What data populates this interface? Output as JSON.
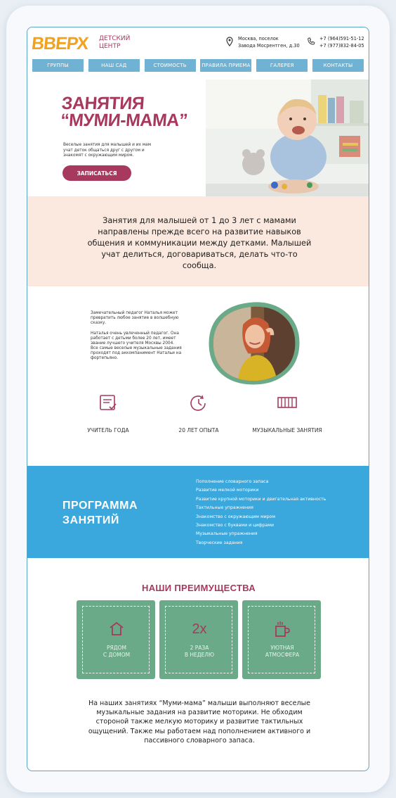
{
  "header": {
    "logo": "ВВЕРХ",
    "subtitle": "ДЕТСКИЙ ЦЕНТР",
    "address_line1": "Москва, поселок",
    "address_line2": "Завода Мосрентген, д.30",
    "phone1": "+7 (964)591-51-12",
    "phone2": "+7 (977)832-84-05"
  },
  "nav": [
    "ГРУППЫ",
    "НАШ САД",
    "СТОИМОСТЬ",
    "ПРАВИЛА ПРИЕМА",
    "ГАЛЕРЕЯ",
    "КОНТАКТЫ"
  ],
  "hero": {
    "title_line1": "ЗАНЯТИЯ",
    "title_line2": "“МУМИ-МАМА”",
    "description": "Веселые занятия для малышей и их мам учат деток общаться друг с другом и знакомят с окружающим миром.",
    "cta": "ЗАПИСАТЬСЯ"
  },
  "intro": "Занятия для малышей  от 1 до 3 лет с мамами направлены прежде всего на развитие навыков общения и коммуникации между детками. Малышей учат делиться, договариваться, делать что-то сообща.",
  "teacher": {
    "p1": "Замечательный педагог Наталья может превратить любое занятие в волшебную сказку.",
    "p2": "Наталья очень увлеченный педагог. Она работает с детьми более 20 лет, имеет звание лучшего учителя Москвы 2004.",
    "p3": "Все самые веселые музыкальные задания проходят под аккомпанимент Натальи на фортепьяно."
  },
  "features": [
    {
      "icon": "certificate-icon",
      "label": "УЧИТЕЛЬ ГОДА"
    },
    {
      "icon": "clock-icon",
      "label": "20 ЛЕТ ОПЫТА"
    },
    {
      "icon": "piano-icon",
      "label": "МУЗЫКАЛЬНЫЕ ЗАНЯТИЯ"
    }
  ],
  "program": {
    "title_line1": "ПРОГРАММА",
    "title_line2": "ЗАНЯТИЙ",
    "items": [
      "Пополнение словарного запаса",
      "Развитие мелкой моторики",
      "Развитие крупной моторики и двигательная активность",
      "Тактильные упражнения",
      "Знакомство с окружающим миром",
      "Знакомство с буквами и цифрами",
      "Музыкальные упражнения",
      "Творческие задания"
    ]
  },
  "advantages": {
    "title": "НАШИ ПРЕИМУЩЕСТВА",
    "cards": [
      {
        "icon": "house-icon",
        "line1": "РЯДОМ",
        "line2": "С ДОМОМ"
      },
      {
        "icon": "twice-icon",
        "icon_text": "2х",
        "line1": "2 РАЗА",
        "line2": "В НЕДЕЛЮ"
      },
      {
        "icon": "cup-icon",
        "line1": "УЮТНАЯ",
        "line2": "АТМОСФЕРА"
      }
    ]
  },
  "outro": "На наших занятиях “Муми-мама” малыши выполняют веселые музыкальные задания на развитие моторики. Не обходим стороной также мелкую моторику и развитие тактильных ощущений. Также мы работаем над пополнением активного и пассивного словарного запаса.",
  "colors": {
    "brand": "#a6395d",
    "logo": "#f3a21e",
    "nav": "#6fb2d3",
    "program_bg": "#3aa7dd",
    "advantage_card": "#6aaa88",
    "intro_bg": "#fbe9df"
  }
}
